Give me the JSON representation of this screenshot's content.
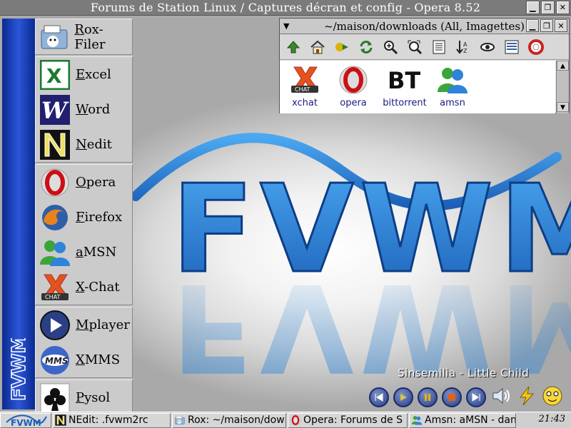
{
  "window": {
    "title": "Forums de Station Linux / Captures décran et config - Opera 8.52",
    "buttons": [
      "minimize",
      "maximize",
      "close"
    ]
  },
  "desktop": {
    "wallpaper_text": "FVWM",
    "side_logo": "FVWM"
  },
  "launcher": {
    "groups": [
      {
        "items": [
          {
            "label": "Rox-Filer",
            "icon": "rox-filer-icon"
          }
        ]
      },
      {
        "items": [
          {
            "label": "Excel",
            "icon": "excel-icon"
          },
          {
            "label": "Word",
            "icon": "word-icon"
          },
          {
            "label": "Nedit",
            "icon": "nedit-icon"
          }
        ]
      },
      {
        "items": [
          {
            "label": "Opera",
            "icon": "opera-icon"
          },
          {
            "label": "Firefox",
            "icon": "firefox-icon"
          },
          {
            "label": "aMSN",
            "icon": "amsn-icon"
          },
          {
            "label": "X-Chat",
            "icon": "xchat-icon"
          }
        ]
      },
      {
        "items": [
          {
            "label": "Mplayer",
            "icon": "mplayer-icon"
          },
          {
            "label": "XMMS",
            "icon": "xmms-icon"
          }
        ]
      },
      {
        "items": [
          {
            "label": "Pysol",
            "icon": "pysol-icon"
          }
        ]
      }
    ]
  },
  "rox": {
    "title": "~/maison/downloads (All, Imagettes)",
    "toolbar": [
      "up-icon",
      "home-icon",
      "bookmarks-icon",
      "refresh-icon",
      "zoom-in-icon",
      "fit-icon",
      "details-icon",
      "sort-icon",
      "show-hidden-icon",
      "list-icon",
      "help-icon"
    ],
    "files": [
      {
        "label": "xchat",
        "icon": "xchat-icon"
      },
      {
        "label": "opera",
        "icon": "opera-icon"
      },
      {
        "label": "bittorrent",
        "icon": "bittorrent-icon"
      },
      {
        "label": "amsn",
        "icon": "amsn-icon"
      }
    ],
    "bt_glyph": "BT"
  },
  "player": {
    "song": "Sinsemilia - Little Child",
    "controls": [
      "previous",
      "play",
      "pause",
      "stop",
      "next",
      "volume",
      "eject",
      "smiley"
    ]
  },
  "taskbar": {
    "tasks": [
      {
        "label": "NEdit: .fvwm2rc",
        "icon": "nedit-icon"
      },
      {
        "label": "Rox: ~/maison/downl",
        "icon": "rox-filer-icon"
      },
      {
        "label": "Opera: Forums de S",
        "icon": "opera-icon"
      },
      {
        "label": "Amsn: aMSN - dan",
        "icon": "amsn-icon"
      }
    ],
    "clock": "21:43"
  },
  "colors": {
    "fvwm_blue": "#2a7fd0",
    "launcher_bar": "#1a3fb5",
    "title_bar": "#7b7b7b"
  }
}
